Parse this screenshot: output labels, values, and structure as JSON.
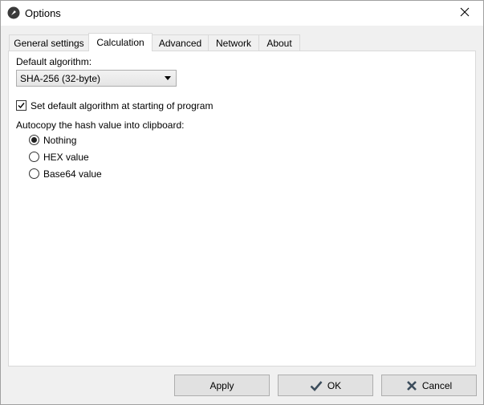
{
  "window": {
    "title": "Options"
  },
  "tabs": [
    {
      "label": "General settings",
      "active": false
    },
    {
      "label": "Calculation",
      "active": true
    },
    {
      "label": "Advanced",
      "active": false
    },
    {
      "label": "Network",
      "active": false
    },
    {
      "label": "About",
      "active": false
    }
  ],
  "calculation": {
    "default_algorithm_label": "Default algorithm:",
    "default_algorithm_value": "SHA-256 (32-byte)",
    "set_default_checkbox": {
      "label": "Set default algorithm at starting of program",
      "checked": true
    },
    "autocopy_label": "Autocopy the hash value into clipboard:",
    "autocopy_options": [
      {
        "label": "Nothing",
        "selected": true
      },
      {
        "label": "HEX value",
        "selected": false
      },
      {
        "label": "Base64 value",
        "selected": false
      }
    ]
  },
  "buttons": {
    "apply": "Apply",
    "ok": "OK",
    "cancel": "Cancel"
  },
  "colors": {
    "ok_check": "#3c4d5c",
    "cancel_x": "#3c4d5c"
  }
}
